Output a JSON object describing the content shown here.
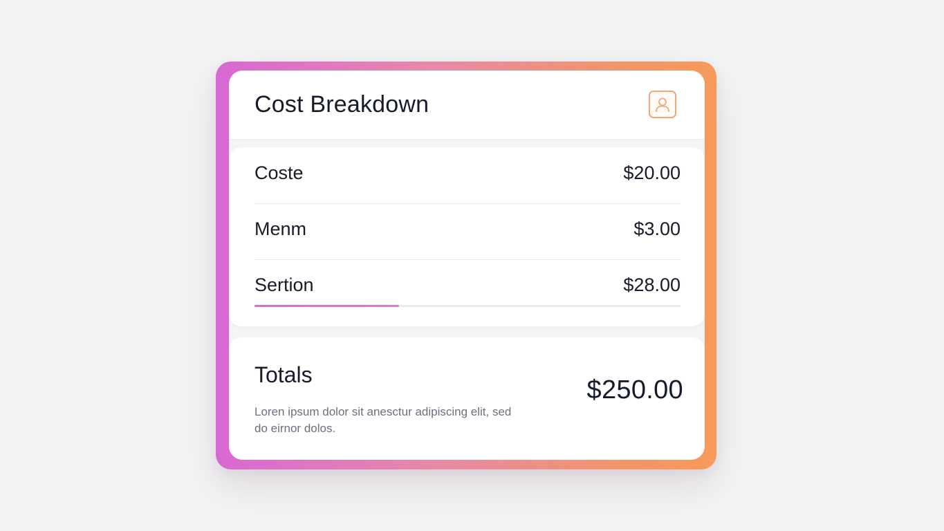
{
  "header": {
    "title": "Cost Breakdown",
    "profile_icon": "user-icon"
  },
  "items": [
    {
      "label": "Coste",
      "value": "$20.00"
    },
    {
      "label": "Menm",
      "value": "$3.00"
    },
    {
      "label": "Sertion",
      "value": "$28.00"
    }
  ],
  "progress": {
    "fraction": 0.34
  },
  "totals": {
    "label": "Totals",
    "value": "$250.00",
    "description": "Loren ipsum dolor sit anesctur adipiscing elit, sed do eirnor dolos."
  },
  "colors": {
    "gradient_start": "#d868d4",
    "gradient_end": "#f79a5a",
    "icon_accent": "#f0a57b",
    "text_primary": "#171a2b"
  }
}
